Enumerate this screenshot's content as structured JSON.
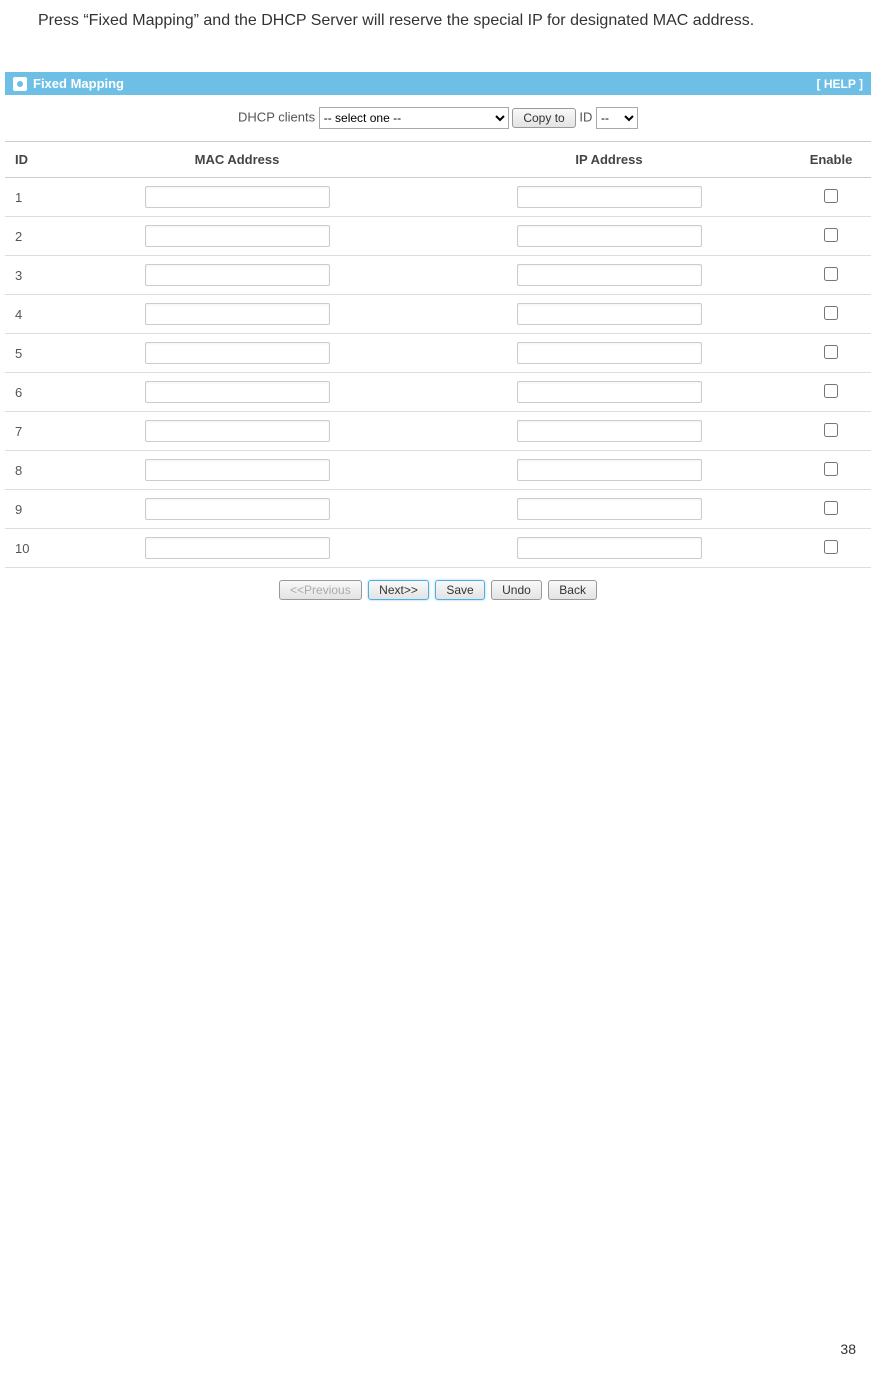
{
  "intro": "Press “Fixed Mapping” and the DHCP Server will reserve the special IP for designated MAC address.",
  "panel": {
    "title": "Fixed Mapping",
    "help": "[ HELP ]"
  },
  "topControls": {
    "clientsLabel": "DHCP clients",
    "clientOption": "-- select one --",
    "copyButton": "Copy to",
    "idLabel": "ID",
    "idOption": "--"
  },
  "columns": {
    "id": "ID",
    "mac": "MAC Address",
    "ip": "IP Address",
    "enable": "Enable"
  },
  "rows": [
    {
      "id": "1",
      "mac": "",
      "ip": "",
      "enable": false
    },
    {
      "id": "2",
      "mac": "",
      "ip": "",
      "enable": false
    },
    {
      "id": "3",
      "mac": "",
      "ip": "",
      "enable": false
    },
    {
      "id": "4",
      "mac": "",
      "ip": "",
      "enable": false
    },
    {
      "id": "5",
      "mac": "",
      "ip": "",
      "enable": false
    },
    {
      "id": "6",
      "mac": "",
      "ip": "",
      "enable": false
    },
    {
      "id": "7",
      "mac": "",
      "ip": "",
      "enable": false
    },
    {
      "id": "8",
      "mac": "",
      "ip": "",
      "enable": false
    },
    {
      "id": "9",
      "mac": "",
      "ip": "",
      "enable": false
    },
    {
      "id": "10",
      "mac": "",
      "ip": "",
      "enable": false
    }
  ],
  "buttons": {
    "previous": "<<Previous",
    "next": "Next>>",
    "save": "Save",
    "undo": "Undo",
    "back": "Back"
  },
  "pageNumber": "38"
}
